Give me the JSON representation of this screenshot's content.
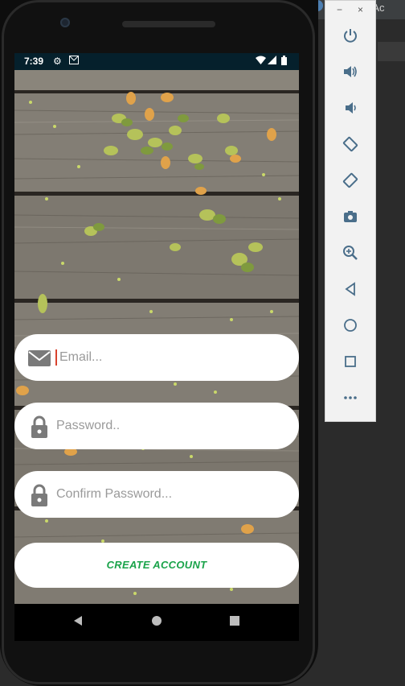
{
  "ide": {
    "title_fragment": "ntsAc"
  },
  "statusbar": {
    "time": "7:39",
    "icons": [
      "settings-icon",
      "gmail-icon",
      "wifi-icon",
      "signal-icon",
      "battery-icon"
    ]
  },
  "form": {
    "email_placeholder": "Email...",
    "password_placeholder": "Password..",
    "confirm_password_placeholder": "Confirm Password...",
    "create_button": "CREATE ACCOUNT"
  },
  "navbar": {
    "icons": [
      "back-icon",
      "home-icon",
      "recents-icon"
    ]
  },
  "emulator": {
    "window_controls": [
      "−",
      "×"
    ],
    "buttons": [
      "power-icon",
      "volume-up-icon",
      "volume-down-icon",
      "rotate-left-icon",
      "rotate-right-icon",
      "camera-icon",
      "zoom-icon",
      "back-icon",
      "home-icon",
      "overview-icon",
      "more-icon"
    ]
  },
  "colors": {
    "accent_green": "#1aa34a",
    "status_bar": "#05202c",
    "cursor": "#d8432e"
  }
}
